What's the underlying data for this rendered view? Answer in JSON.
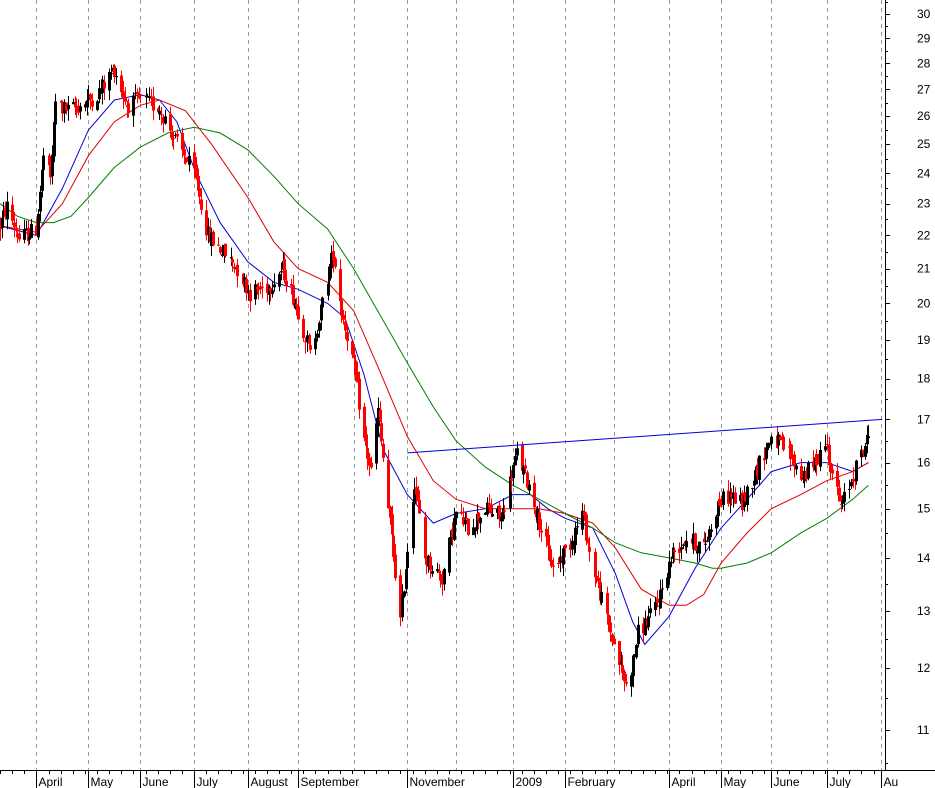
{
  "chart_data": {
    "type": "candlestick",
    "title": "",
    "xlabel": "",
    "ylabel": "",
    "y_scale": "log",
    "ylim": [
      10.4,
      30.6
    ],
    "y_ticks": [
      11,
      12,
      13,
      14,
      15,
      16,
      17,
      18,
      19,
      20,
      21,
      22,
      23,
      24,
      25,
      26,
      27,
      28,
      29,
      30
    ],
    "x_range": [
      "2008-03-10",
      "2009-08-02"
    ],
    "x_month_labels": [
      {
        "date": "2008-03-31",
        "label": "April"
      },
      {
        "date": "2008-04-30",
        "label": "May"
      },
      {
        "date": "2008-05-30",
        "label": "June"
      },
      {
        "date": "2008-06-30",
        "label": "July"
      },
      {
        "date": "2008-07-31",
        "label": "August"
      },
      {
        "date": "2008-08-29",
        "label": "September"
      },
      {
        "date": "2008-10-31",
        "label": "November"
      },
      {
        "date": "2008-12-31",
        "label": "2009"
      },
      {
        "date": "2009-01-30",
        "label": "February"
      },
      {
        "date": "2009-03-31",
        "label": "April"
      },
      {
        "date": "2009-04-30",
        "label": "May"
      },
      {
        "date": "2009-05-29",
        "label": "June"
      },
      {
        "date": "2009-06-30",
        "label": "July"
      },
      {
        "date": "2009-07-31",
        "label": "Au"
      }
    ],
    "grid_lines": [
      "2008-03-31",
      "2008-04-30",
      "2008-05-30",
      "2008-06-30",
      "2008-07-31",
      "2008-08-29",
      "2008-09-30",
      "2008-10-31",
      "2008-11-28",
      "2008-12-31",
      "2009-01-30",
      "2009-02-27",
      "2009-03-31",
      "2009-04-30",
      "2009-05-29",
      "2009-06-30",
      "2009-07-31"
    ],
    "price_anchors": [
      [
        "2008-03-10",
        22.3
      ],
      [
        "2008-03-14",
        22.9
      ],
      [
        "2008-03-21",
        21.9
      ],
      [
        "2008-03-31",
        22.2
      ],
      [
        "2008-04-04",
        24.6
      ],
      [
        "2008-04-08",
        23.8
      ],
      [
        "2008-04-11",
        26.5
      ],
      [
        "2008-04-18",
        26.2
      ],
      [
        "2008-04-25",
        26.4
      ],
      [
        "2008-05-05",
        26.8
      ],
      [
        "2008-05-15",
        27.8
      ],
      [
        "2008-05-22",
        26.4
      ],
      [
        "2008-05-30",
        26.6
      ],
      [
        "2008-06-10",
        26.3
      ],
      [
        "2008-06-20",
        25.0
      ],
      [
        "2008-06-30",
        24.0
      ],
      [
        "2008-07-08",
        22.0
      ],
      [
        "2008-07-15",
        21.6
      ],
      [
        "2008-07-25",
        21.0
      ],
      [
        "2008-08-01",
        20.3
      ],
      [
        "2008-08-12",
        20.5
      ],
      [
        "2008-08-20",
        21.0
      ],
      [
        "2008-08-29",
        19.8
      ],
      [
        "2008-09-05",
        18.6
      ],
      [
        "2008-09-12",
        20.0
      ],
      [
        "2008-09-18",
        21.5
      ],
      [
        "2008-09-23",
        19.8
      ],
      [
        "2008-09-30",
        18.3
      ],
      [
        "2008-10-06",
        16.5
      ],
      [
        "2008-10-10",
        15.8
      ],
      [
        "2008-10-14",
        17.2
      ],
      [
        "2008-10-20",
        15.0
      ],
      [
        "2008-10-27",
        12.8
      ],
      [
        "2008-11-04",
        15.6
      ],
      [
        "2008-11-10",
        14.0
      ],
      [
        "2008-11-20",
        13.6
      ],
      [
        "2008-11-28",
        14.9
      ],
      [
        "2008-12-05",
        14.6
      ],
      [
        "2008-12-15",
        15.0
      ],
      [
        "2008-12-24",
        14.8
      ],
      [
        "2009-01-02",
        16.2
      ],
      [
        "2009-01-09",
        15.5
      ],
      [
        "2009-01-16",
        14.6
      ],
      [
        "2009-01-23",
        13.8
      ],
      [
        "2009-02-02",
        14.3
      ],
      [
        "2009-02-09",
        14.9
      ],
      [
        "2009-02-13",
        14.1
      ],
      [
        "2009-02-20",
        13.2
      ],
      [
        "2009-02-27",
        12.4
      ],
      [
        "2009-03-06",
        11.7
      ],
      [
        "2009-03-10",
        12.1
      ],
      [
        "2009-03-13",
        12.6
      ],
      [
        "2009-03-20",
        12.9
      ],
      [
        "2009-03-25",
        13.2
      ],
      [
        "2009-04-02",
        14.1
      ],
      [
        "2009-04-10",
        14.4
      ],
      [
        "2009-04-20",
        14.2
      ],
      [
        "2009-04-28",
        15.1
      ],
      [
        "2009-05-05",
        15.3
      ],
      [
        "2009-05-12",
        15.1
      ],
      [
        "2009-05-20",
        15.8
      ],
      [
        "2009-05-29",
        16.6
      ],
      [
        "2009-06-08",
        16.2
      ],
      [
        "2009-06-15",
        15.7
      ],
      [
        "2009-06-22",
        15.9
      ],
      [
        "2009-06-29",
        16.5
      ],
      [
        "2009-07-03",
        15.8
      ],
      [
        "2009-07-08",
        15.0
      ],
      [
        "2009-07-14",
        15.6
      ],
      [
        "2009-07-20",
        16.2
      ],
      [
        "2009-07-24",
        16.6
      ]
    ],
    "moving_averages": [
      {
        "color": "#0000dd",
        "points": [
          [
            "2008-03-10",
            22.3
          ],
          [
            "2008-03-31",
            22.0
          ],
          [
            "2008-04-15",
            23.5
          ],
          [
            "2008-04-30",
            25.5
          ],
          [
            "2008-05-15",
            26.6
          ],
          [
            "2008-05-30",
            26.8
          ],
          [
            "2008-06-10",
            26.6
          ],
          [
            "2008-06-20",
            25.8
          ],
          [
            "2008-07-01",
            24.0
          ],
          [
            "2008-07-15",
            22.4
          ],
          [
            "2008-07-31",
            21.2
          ],
          [
            "2008-08-15",
            20.6
          ],
          [
            "2008-08-29",
            20.4
          ],
          [
            "2008-09-15",
            20.0
          ],
          [
            "2008-09-25",
            19.6
          ],
          [
            "2008-10-06",
            18.1
          ],
          [
            "2008-10-17",
            16.3
          ],
          [
            "2008-10-31",
            15.3
          ],
          [
            "2008-11-15",
            14.7
          ],
          [
            "2008-11-28",
            14.9
          ],
          [
            "2008-12-15",
            15.0
          ],
          [
            "2008-12-31",
            15.3
          ],
          [
            "2009-01-10",
            15.3
          ],
          [
            "2009-01-20",
            15.0
          ],
          [
            "2009-01-30",
            14.8
          ],
          [
            "2009-02-15",
            14.6
          ],
          [
            "2009-02-28",
            13.7
          ],
          [
            "2009-03-10",
            12.8
          ],
          [
            "2009-03-17",
            12.4
          ],
          [
            "2009-03-31",
            12.9
          ],
          [
            "2009-04-15",
            13.8
          ],
          [
            "2009-04-30",
            14.6
          ],
          [
            "2009-05-15",
            15.2
          ],
          [
            "2009-05-29",
            15.8
          ],
          [
            "2009-06-15",
            16.0
          ],
          [
            "2009-06-30",
            16.0
          ],
          [
            "2009-07-15",
            15.8
          ],
          [
            "2009-07-24",
            16.0
          ]
        ]
      },
      {
        "color": "#dd0000",
        "points": [
          [
            "2008-03-10",
            22.3
          ],
          [
            "2008-03-31",
            22.1
          ],
          [
            "2008-04-15",
            23.0
          ],
          [
            "2008-04-30",
            24.6
          ],
          [
            "2008-05-15",
            25.8
          ],
          [
            "2008-05-30",
            26.4
          ],
          [
            "2008-06-10",
            26.6
          ],
          [
            "2008-06-25",
            26.2
          ],
          [
            "2008-07-10",
            25.0
          ],
          [
            "2008-07-31",
            23.2
          ],
          [
            "2008-08-15",
            21.8
          ],
          [
            "2008-08-29",
            21.0
          ],
          [
            "2008-09-15",
            20.6
          ],
          [
            "2008-09-30",
            19.8
          ],
          [
            "2008-10-15",
            18.2
          ],
          [
            "2008-10-31",
            16.6
          ],
          [
            "2008-11-15",
            15.6
          ],
          [
            "2008-11-28",
            15.2
          ],
          [
            "2008-12-15",
            15.0
          ],
          [
            "2008-12-31",
            15.0
          ],
          [
            "2009-01-15",
            15.0
          ],
          [
            "2009-01-30",
            14.9
          ],
          [
            "2009-02-15",
            14.7
          ],
          [
            "2009-02-28",
            14.2
          ],
          [
            "2009-03-15",
            13.4
          ],
          [
            "2009-03-31",
            13.1
          ],
          [
            "2009-04-10",
            13.1
          ],
          [
            "2009-04-20",
            13.3
          ],
          [
            "2009-04-30",
            13.9
          ],
          [
            "2009-05-15",
            14.5
          ],
          [
            "2009-05-29",
            15.0
          ],
          [
            "2009-06-15",
            15.3
          ],
          [
            "2009-06-30",
            15.6
          ],
          [
            "2009-07-15",
            15.8
          ],
          [
            "2009-07-24",
            16.0
          ]
        ]
      },
      {
        "color": "#008000",
        "points": [
          [
            "2008-03-10",
            23.0
          ],
          [
            "2008-03-20",
            22.6
          ],
          [
            "2008-03-31",
            22.4
          ],
          [
            "2008-04-10",
            22.4
          ],
          [
            "2008-04-20",
            22.6
          ],
          [
            "2008-04-30",
            23.2
          ],
          [
            "2008-05-15",
            24.2
          ],
          [
            "2008-05-30",
            24.9
          ],
          [
            "2008-06-15",
            25.4
          ],
          [
            "2008-06-30",
            25.6
          ],
          [
            "2008-07-15",
            25.4
          ],
          [
            "2008-07-31",
            24.8
          ],
          [
            "2008-08-15",
            23.9
          ],
          [
            "2008-08-29",
            23.0
          ],
          [
            "2008-09-15",
            22.2
          ],
          [
            "2008-09-30",
            21.0
          ],
          [
            "2008-10-15",
            19.7
          ],
          [
            "2008-10-31",
            18.4
          ],
          [
            "2008-11-15",
            17.3
          ],
          [
            "2008-11-28",
            16.5
          ],
          [
            "2008-12-15",
            15.9
          ],
          [
            "2008-12-31",
            15.5
          ],
          [
            "2009-01-15",
            15.2
          ],
          [
            "2009-01-30",
            14.9
          ],
          [
            "2009-02-15",
            14.6
          ],
          [
            "2009-02-28",
            14.3
          ],
          [
            "2009-03-15",
            14.1
          ],
          [
            "2009-03-31",
            14.0
          ],
          [
            "2009-04-15",
            13.9
          ],
          [
            "2009-04-25",
            13.8
          ],
          [
            "2009-04-30",
            13.8
          ],
          [
            "2009-05-15",
            13.9
          ],
          [
            "2009-05-29",
            14.1
          ],
          [
            "2009-06-15",
            14.5
          ],
          [
            "2009-06-30",
            14.8
          ],
          [
            "2009-07-15",
            15.2
          ],
          [
            "2009-07-24",
            15.5
          ]
        ]
      }
    ],
    "trendline": {
      "color": "#0000dd",
      "from": [
        "2008-10-31",
        16.22
      ],
      "to": [
        "2009-08-01",
        17.0
      ]
    }
  }
}
